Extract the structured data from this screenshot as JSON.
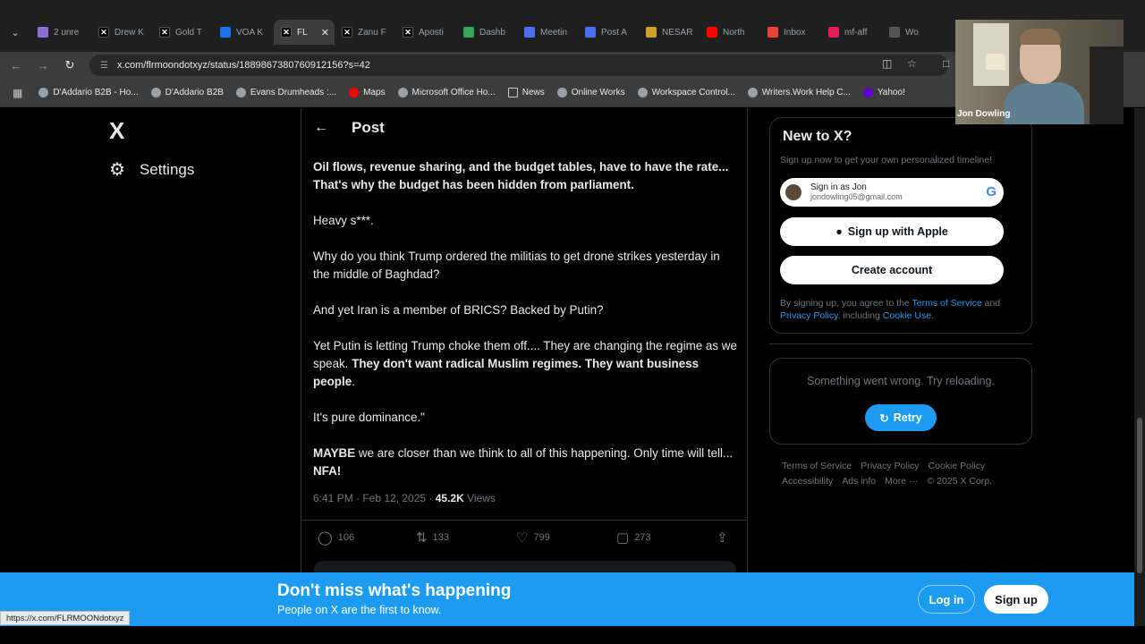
{
  "browser": {
    "tabs": [
      {
        "label": "2 unre",
        "favicon": "purple-mail-icon",
        "color": "#8e6bd6"
      },
      {
        "label": "Drew K",
        "favicon": "x-icon",
        "color": "#000000"
      },
      {
        "label": "Gold T",
        "favicon": "x-icon",
        "color": "#000000"
      },
      {
        "label": "VOA K",
        "favicon": "voa-icon",
        "color": "#1a73e8"
      },
      {
        "label": "FL",
        "favicon": "x-icon",
        "color": "#000000",
        "active": true
      },
      {
        "label": "Zanu F",
        "favicon": "x-icon",
        "color": "#000000"
      },
      {
        "label": "Aposti",
        "favicon": "x-icon",
        "color": "#000000"
      },
      {
        "label": "Dashb",
        "favicon": "dashboard-icon",
        "color": "#34a853"
      },
      {
        "label": "Meetin",
        "favicon": "meeting-icon",
        "color": "#4c6ef5"
      },
      {
        "label": "Post A",
        "favicon": "post-icon",
        "color": "#4c6ef5"
      },
      {
        "label": "NESAR",
        "favicon": "nesar-icon",
        "color": "#c9a227"
      },
      {
        "label": "North",
        "favicon": "youtube-icon",
        "color": "#ff0000"
      },
      {
        "label": "Inbox",
        "favicon": "gmail-icon",
        "color": "#ea4335"
      },
      {
        "label": "mf-aff",
        "favicon": "slack-icon",
        "color": "#e01e5a"
      },
      {
        "label": "Wo",
        "favicon": "site-icon",
        "color": "#555555"
      }
    ],
    "url": "x.com/flrmoondotxyz/status/1889867380760912156?s=42",
    "bookmarks": [
      {
        "label": "D'Addario B2B - Ho..."
      },
      {
        "label": "D'Addario B2B"
      },
      {
        "label": "Evans Drumheads :..."
      },
      {
        "label": "Maps"
      },
      {
        "label": "Microsoft Office Ho..."
      },
      {
        "label": "News"
      },
      {
        "label": "Online Works"
      },
      {
        "label": "Workspace Control..."
      },
      {
        "label": "Writers.Work Help C..."
      },
      {
        "label": "Yahoo!"
      }
    ],
    "status_url": "https://x.com/FLRMOONdotxyz"
  },
  "sidebar": {
    "logo": "X",
    "settings_label": "Settings"
  },
  "post": {
    "header_title": "Post",
    "body": {
      "p1": "Oil flows, revenue sharing, and the budget tables, have to have the rate... That's why the budget has been hidden from parliament.",
      "p2": "Heavy s***.",
      "p3": "Why do you think Trump ordered the militias to get drone strikes yesterday in the middle of Baghdad?",
      "p4": "And yet Iran  is a member of BRICS?  Backed by Putin?",
      "p5a": "Yet Putin is letting Trump choke them off.... They are changing the regime as we speak. ",
      "p5b": "They don't want radical Muslim regimes. They want business people",
      "p5c": ".",
      "p6": " It's pure dominance.\"",
      "p7a": "MAYBE",
      "p7b": " we are closer than we think to all of this happening. Only time will tell... ",
      "p7c": "NFA!"
    },
    "meta_time": "6:41 PM · Feb 12, 2025 · ",
    "views_count": "45.2K",
    "views_label": " Views",
    "actions": {
      "replies": "106",
      "reposts": "133",
      "likes": "799",
      "bookmarks": "273"
    }
  },
  "right": {
    "new_title": "New to X?",
    "new_sub": "Sign up now to get your own personalized timeline!",
    "google_line1": "Sign in as Jon",
    "google_line2": "jondowling05@gmail.com",
    "apple_label": "Sign up with Apple",
    "create_label": "Create account",
    "legal_pre": "By signing up, you agree to the ",
    "legal_terms": "Terms of Service",
    "legal_and": " and ",
    "legal_privacy": "Privacy Policy",
    "legal_incl": ", including ",
    "legal_cookie": "Cookie Use",
    "legal_end": ".",
    "error_text": "Something went wrong. Try reloading.",
    "retry_label": "Retry",
    "footer": {
      "terms": "Terms of Service",
      "privacy": "Privacy Policy",
      "cookie": "Cookie Policy",
      "accessibility": "Accessibility",
      "ads": "Ads info",
      "more": "More ···",
      "copyright": "© 2025 X Corp."
    }
  },
  "banner": {
    "title": "Don't miss what's happening",
    "subtitle": "People on X are the first to know.",
    "login_label": "Log in",
    "signup_label": "Sign up"
  },
  "webcam": {
    "name": "Jon Dowling"
  },
  "colors": {
    "accent": "#1d9bf0",
    "background": "#000000",
    "muted": "#71767b"
  }
}
